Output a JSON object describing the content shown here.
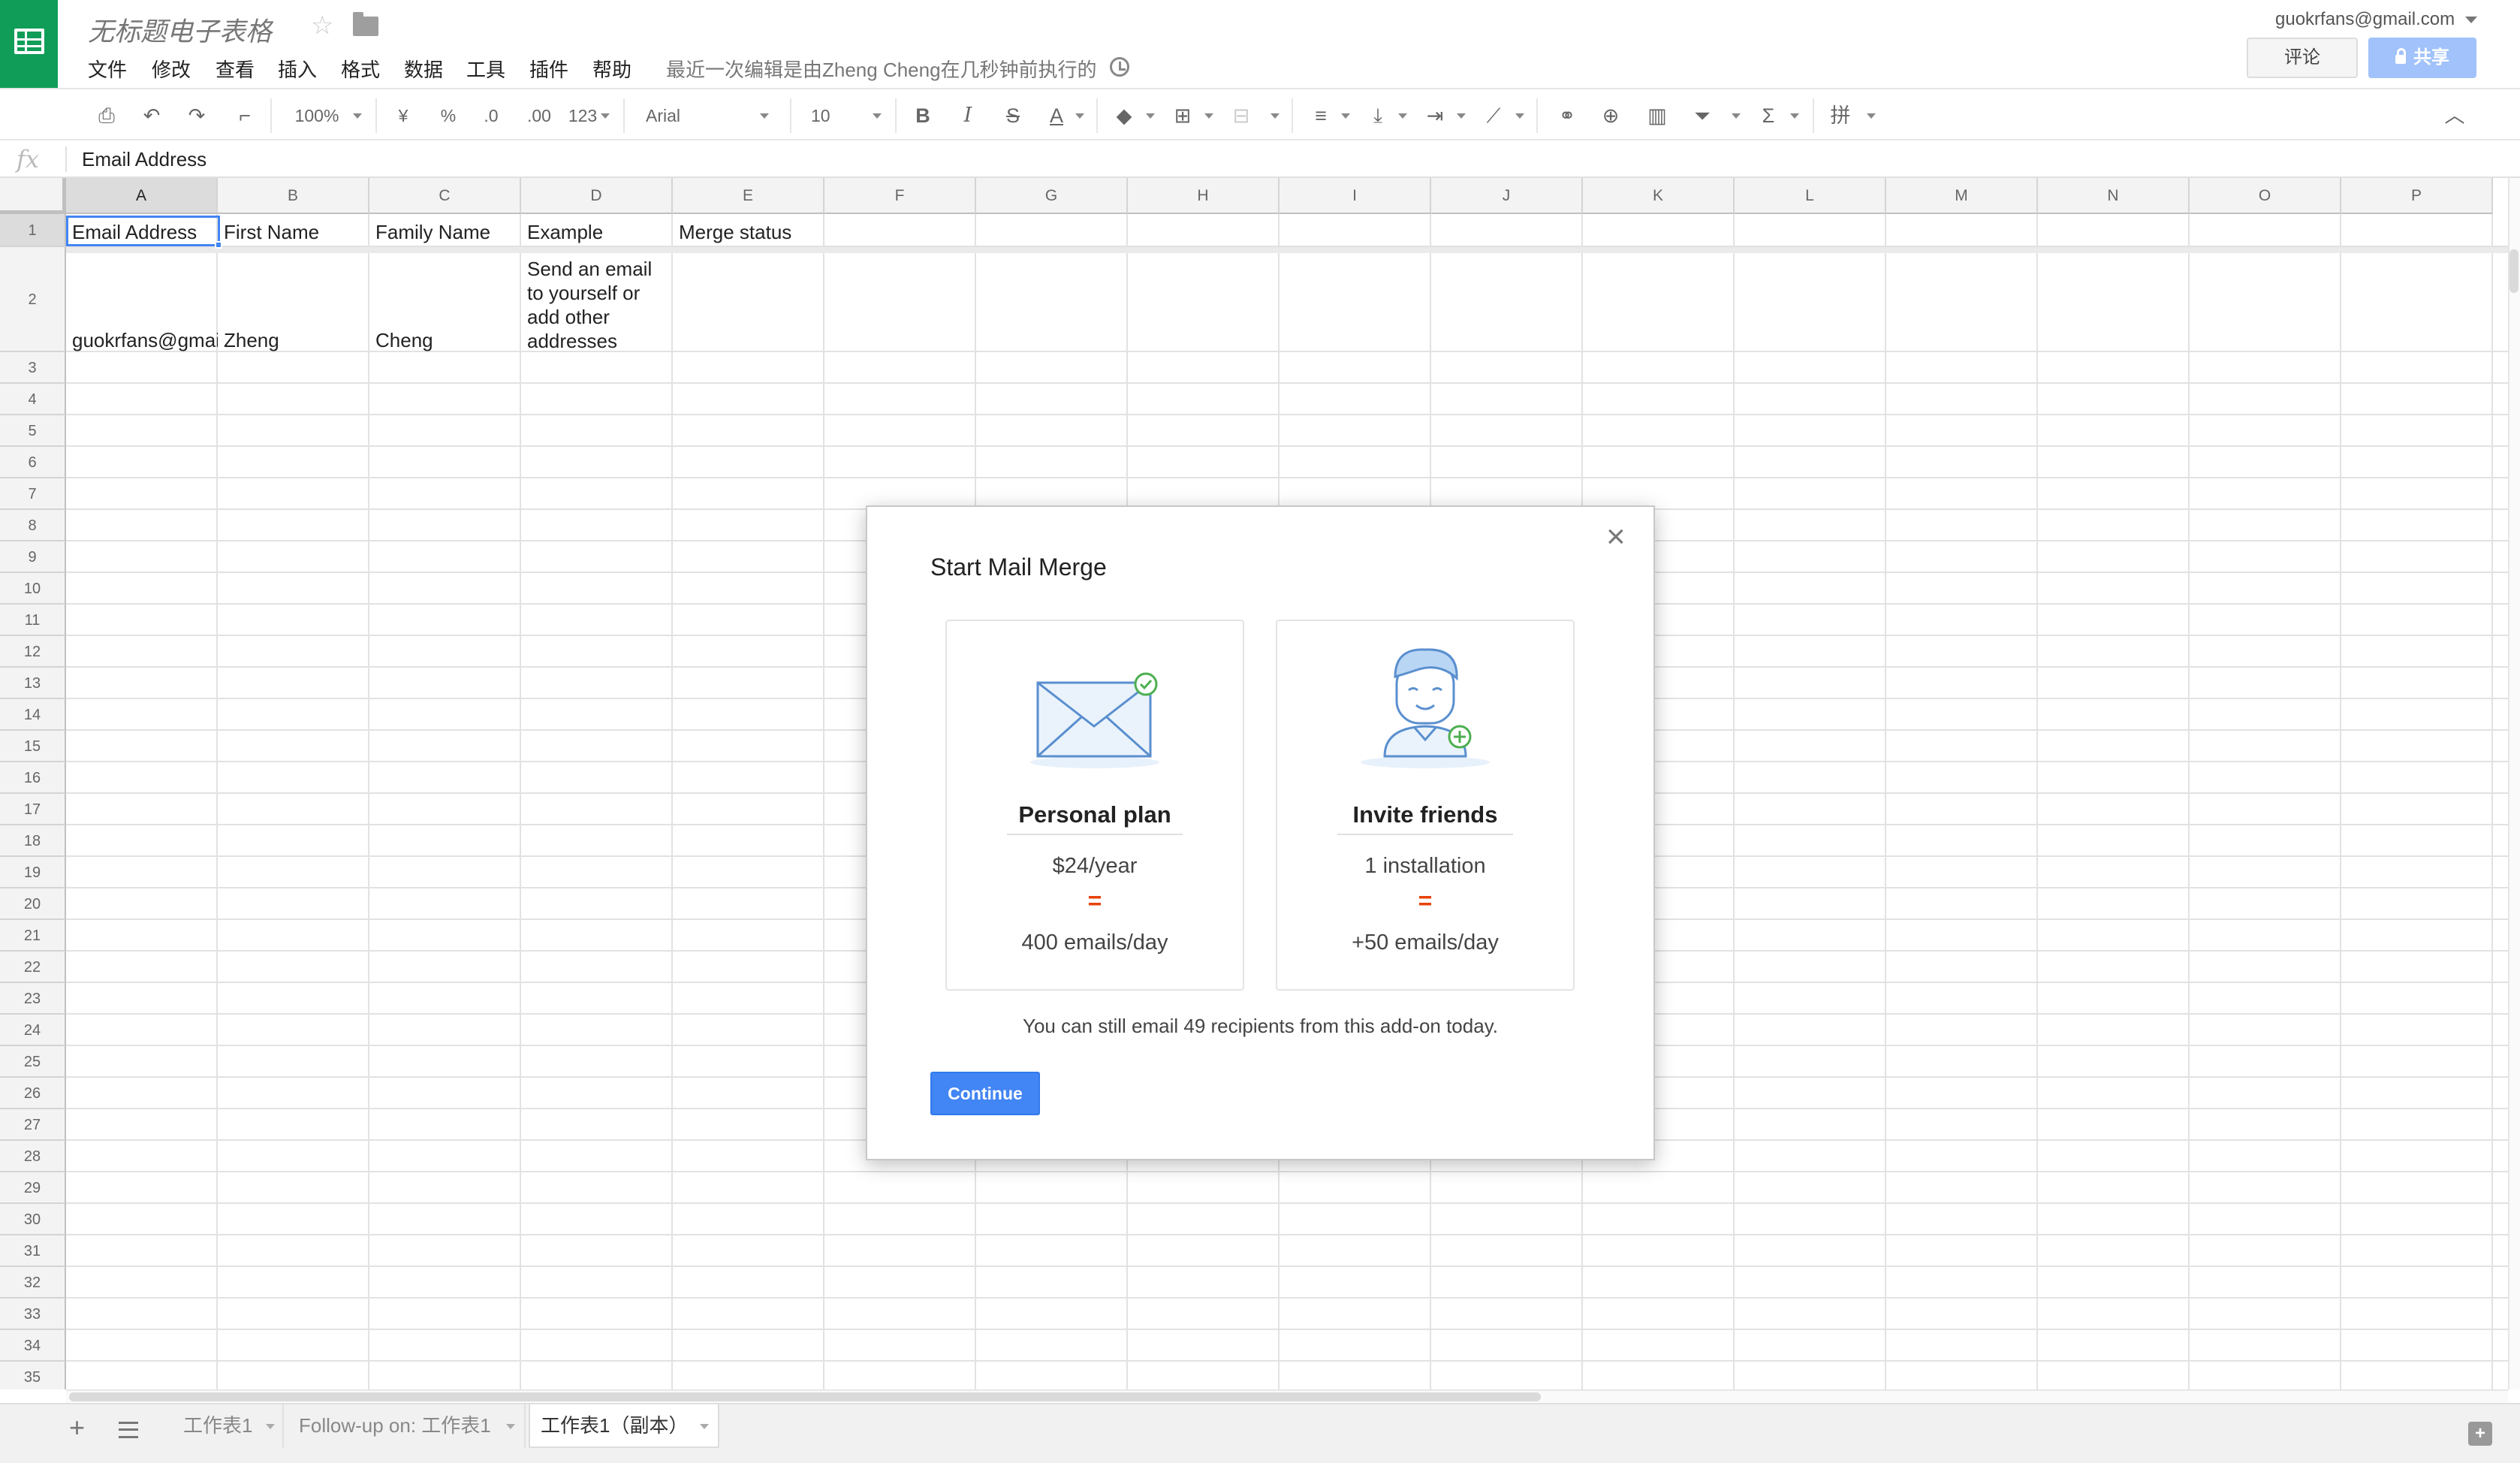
{
  "app": {
    "doc_title": "无标题电子表格",
    "menu": [
      "文件",
      "修改",
      "查看",
      "插入",
      "格式",
      "数据",
      "工具",
      "插件",
      "帮助"
    ],
    "last_edit": "最近一次编辑是由Zheng Cheng在几秒钟前执行的",
    "account": "guokrfans@gmail.com",
    "comment_label": "评论",
    "share_label": "共享"
  },
  "toolbar": {
    "zoom": "100%",
    "currency": "¥",
    "percent": "%",
    "dec_less": ".0",
    "dec_more": ".00",
    "more_formats": "123",
    "font": "Arial",
    "font_size": "10",
    "bold": "B",
    "italic": "I",
    "strike": "S",
    "text_color": "A",
    "functions": "Σ"
  },
  "formula_bar": {
    "fx": "fx",
    "content": "Email Address"
  },
  "sheet": {
    "columns": [
      "A",
      "B",
      "C",
      "D",
      "E",
      "F",
      "G",
      "H",
      "I",
      "J",
      "K",
      "L",
      "M",
      "N",
      "O",
      "P"
    ],
    "header_row": [
      "Email Address",
      "First Name",
      "Family Name",
      "Example",
      "Merge status"
    ],
    "row2": {
      "a": "guokrfans@gmai",
      "b": "Zheng",
      "c": "Cheng",
      "d1": "Send an email",
      "d2": "to yourself or",
      "d3": "add other",
      "d4": "addresses"
    }
  },
  "tabs": [
    "工作表1",
    "Follow-up on: 工作表1",
    "工作表1（副本）"
  ],
  "modal": {
    "title": "Start Mail Merge",
    "close": "×",
    "cards": [
      {
        "icon": "envelope-check-icon",
        "title": "Personal plan",
        "line1": "$24/year",
        "eq": "=",
        "line2": "400 emails/day"
      },
      {
        "icon": "person-plus-icon",
        "title": "Invite friends",
        "line1": "1 installation",
        "eq": "=",
        "line2": "+50 emails/day"
      }
    ],
    "note": "You can still email 49 recipients from this add-on today.",
    "continue_label": "Continue"
  },
  "colors": {
    "sheets_green": "#0f9d58",
    "accent_blue": "#4285f4",
    "share_blue": "#a1c2fa",
    "equals_orange": "#e8430a",
    "check_green": "#4caf50"
  }
}
